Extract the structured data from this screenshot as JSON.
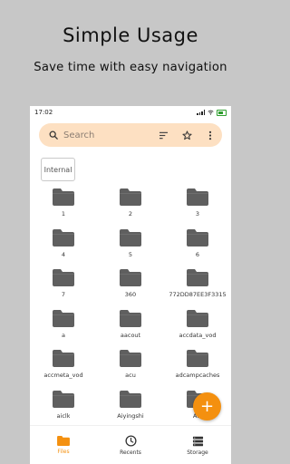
{
  "promo": {
    "headline": "Simple Usage",
    "subline": "Save time with easy navigation"
  },
  "statusbar": {
    "time": "17:02"
  },
  "search": {
    "placeholder": "Search"
  },
  "storage_chip": "Internal",
  "folders": [
    {
      "name": "1"
    },
    {
      "name": "2"
    },
    {
      "name": "3"
    },
    {
      "name": "4"
    },
    {
      "name": "5"
    },
    {
      "name": "6"
    },
    {
      "name": "7"
    },
    {
      "name": "360"
    },
    {
      "name": "772DD87EE3F3315"
    },
    {
      "name": "a"
    },
    {
      "name": "aacout"
    },
    {
      "name": "accdata_vod"
    },
    {
      "name": "accmeta_vod"
    },
    {
      "name": "acu"
    },
    {
      "name": "adcampcaches"
    },
    {
      "name": "aiclk"
    },
    {
      "name": "Aiyingshi"
    },
    {
      "name": "Ala"
    }
  ],
  "fab_label": "+",
  "nav": {
    "files": "Files",
    "recents": "Recents",
    "storage": "Storage"
  },
  "colors": {
    "accent": "#f4900f",
    "search_bg": "#fde0c2",
    "folder": "#5f5f5f",
    "background": "#c7c7c7"
  }
}
